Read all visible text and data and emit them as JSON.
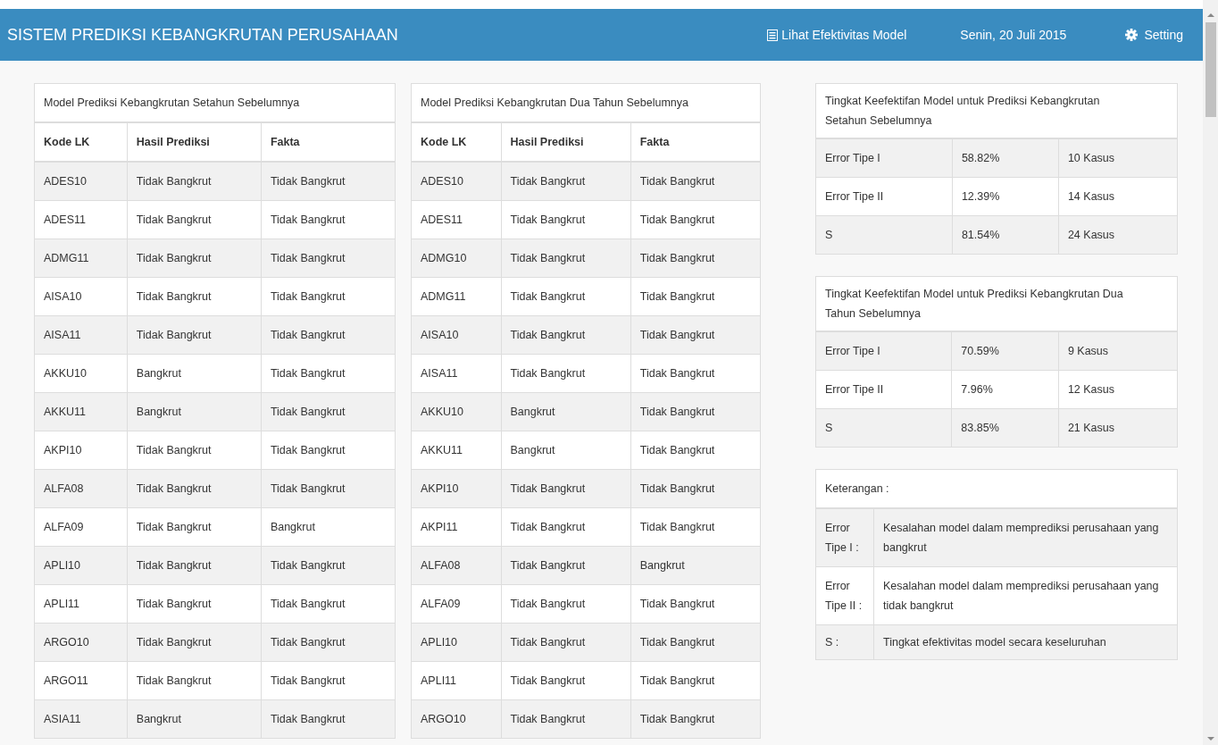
{
  "header": {
    "title": "SISTEM PREDIKSI KEBANGKRUTAN PERUSAHAAN",
    "link": "Lihat Efektivitas Model",
    "date": "Senin, 20 Juli 2015",
    "setting": "Setting"
  },
  "prediction_tables": [
    {
      "title": "Model Prediksi Kebangkrutan Setahun Sebelumnya",
      "columns": [
        "Kode LK",
        "Hasil Prediksi",
        "Fakta"
      ],
      "rows": [
        [
          "ADES10",
          "Tidak Bangkrut",
          "Tidak Bangkrut"
        ],
        [
          "ADES11",
          "Tidak Bangkrut",
          "Tidak Bangkrut"
        ],
        [
          "ADMG11",
          "Tidak Bangkrut",
          "Tidak Bangkrut"
        ],
        [
          "AISA10",
          "Tidak Bangkrut",
          "Tidak Bangkrut"
        ],
        [
          "AISA11",
          "Tidak Bangkrut",
          "Tidak Bangkrut"
        ],
        [
          "AKKU10",
          "Bangkrut",
          "Tidak Bangkrut"
        ],
        [
          "AKKU11",
          "Bangkrut",
          "Tidak Bangkrut"
        ],
        [
          "AKPI10",
          "Tidak Bangkrut",
          "Tidak Bangkrut"
        ],
        [
          "ALFA08",
          "Tidak Bangkrut",
          "Tidak Bangkrut"
        ],
        [
          "ALFA09",
          "Tidak Bangkrut",
          "Bangkrut"
        ],
        [
          "APLI10",
          "Tidak Bangkrut",
          "Tidak Bangkrut"
        ],
        [
          "APLI11",
          "Tidak Bangkrut",
          "Tidak Bangkrut"
        ],
        [
          "ARGO10",
          "Tidak Bangkrut",
          "Tidak Bangkrut"
        ],
        [
          "ARGO11",
          "Tidak Bangkrut",
          "Tidak Bangkrut"
        ],
        [
          "ASIA11",
          "Bangkrut",
          "Tidak Bangkrut"
        ]
      ]
    },
    {
      "title": "Model Prediksi Kebangkrutan Dua Tahun Sebelumnya",
      "columns": [
        "Kode LK",
        "Hasil Prediksi",
        "Fakta"
      ],
      "rows": [
        [
          "ADES10",
          "Tidak Bangkrut",
          "Tidak Bangkrut"
        ],
        [
          "ADES11",
          "Tidak Bangkrut",
          "Tidak Bangkrut"
        ],
        [
          "ADMG10",
          "Tidak Bangkrut",
          "Tidak Bangkrut"
        ],
        [
          "ADMG11",
          "Tidak Bangkrut",
          "Tidak Bangkrut"
        ],
        [
          "AISA10",
          "Tidak Bangkrut",
          "Tidak Bangkrut"
        ],
        [
          "AISA11",
          "Tidak Bangkrut",
          "Tidak Bangkrut"
        ],
        [
          "AKKU10",
          "Bangkrut",
          "Tidak Bangkrut"
        ],
        [
          "AKKU11",
          "Bangkrut",
          "Tidak Bangkrut"
        ],
        [
          "AKPI10",
          "Tidak Bangkrut",
          "Tidak Bangkrut"
        ],
        [
          "AKPI11",
          "Tidak Bangkrut",
          "Tidak Bangkrut"
        ],
        [
          "ALFA08",
          "Tidak Bangkrut",
          "Bangkrut"
        ],
        [
          "ALFA09",
          "Tidak Bangkrut",
          "Tidak Bangkrut"
        ],
        [
          "APLI10",
          "Tidak Bangkrut",
          "Tidak Bangkrut"
        ],
        [
          "APLI11",
          "Tidak Bangkrut",
          "Tidak Bangkrut"
        ],
        [
          "ARGO10",
          "Tidak Bangkrut",
          "Tidak Bangkrut"
        ]
      ]
    }
  ],
  "effectiveness_tables": [
    {
      "title": "Tingkat Keefektifan Model untuk Prediksi Kebangkrutan Setahun Sebelumnya",
      "rows": [
        [
          "Error Tipe I",
          "58.82%",
          "10 Kasus"
        ],
        [
          "Error Tipe II",
          "12.39%",
          "14 Kasus"
        ],
        [
          "S",
          "81.54%",
          "24 Kasus"
        ]
      ]
    },
    {
      "title": "Tingkat Keefektifan Model untuk Prediksi Kebangkrutan Dua Tahun Sebelumnya",
      "rows": [
        [
          "Error Tipe I",
          "70.59%",
          "9 Kasus"
        ],
        [
          "Error Tipe II",
          "7.96%",
          "12 Kasus"
        ],
        [
          "S",
          "83.85%",
          "21 Kasus"
        ]
      ]
    }
  ],
  "legend": {
    "title": "Keterangan :",
    "rows": [
      [
        "Error Tipe I :",
        "Kesalahan model dalam memprediksi perusahaan yang bangkrut"
      ],
      [
        "Error Tipe II :",
        "Kesalahan model dalam memprediksi perusahaan yang tidak bangkrut"
      ],
      [
        "S :",
        "Tingkat efektivitas model secara keseluruhan"
      ]
    ]
  }
}
